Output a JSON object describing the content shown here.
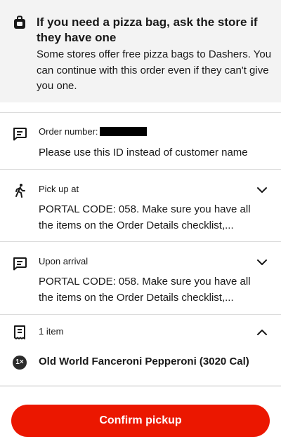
{
  "banner": {
    "icon": "pizza-bag-icon",
    "title": "If you need a pizza bag, ask the store if they have one",
    "body": "Some stores offer free pizza bags to Dashers. You can continue with this order even if they can't give you one."
  },
  "order_number": {
    "icon": "message-icon",
    "label": "Order number:",
    "note": "Please use this ID instead of customer name"
  },
  "pickup": {
    "icon": "walking-person-icon",
    "label": "Pick up at",
    "text": "PORTAL CODE: 058. Make sure you  have all the items on the Order Details checklist,..."
  },
  "arrival": {
    "icon": "message-icon",
    "label": "Upon arrival",
    "text": "PORTAL CODE: 058. Make sure you  have all the items on the Order Details checklist,..."
  },
  "items": {
    "icon": "receipt-icon",
    "count_label": "1 item",
    "list": [
      {
        "qty": "1×",
        "name": "Old World Fanceroni Pepperoni (3020 Cal)"
      }
    ]
  },
  "footer": {
    "confirm_label": "Confirm pickup"
  },
  "colors": {
    "accent": "#eb1700",
    "banner_bg": "#f3f3f3"
  }
}
